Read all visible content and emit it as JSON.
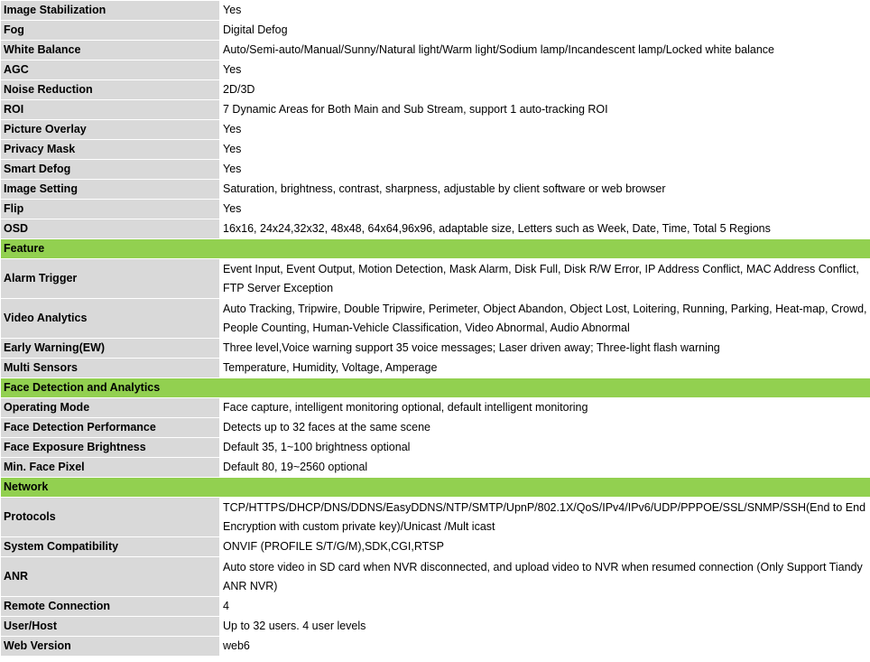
{
  "rows": [
    {
      "type": "row",
      "key": "Image Stabilization",
      "value": "Yes"
    },
    {
      "type": "row",
      "key": "Fog",
      "value": "Digital Defog"
    },
    {
      "type": "row",
      "key": "White Balance",
      "value": "Auto/Semi-auto/Manual/Sunny/Natural light/Warm light/Sodium lamp/Incandescent lamp/Locked white balance"
    },
    {
      "type": "row",
      "key": "AGC",
      "value": "Yes"
    },
    {
      "type": "row",
      "key": "Noise Reduction",
      "value": "2D/3D"
    },
    {
      "type": "row",
      "key": "ROI",
      "value": "7 Dynamic Areas for Both Main and Sub Stream, support 1 auto-tracking ROI"
    },
    {
      "type": "row",
      "key": "Picture Overlay",
      "value": "Yes"
    },
    {
      "type": "row",
      "key": "Privacy Mask",
      "value": "Yes"
    },
    {
      "type": "row",
      "key": "Smart Defog",
      "value": "Yes"
    },
    {
      "type": "row",
      "key": "Image Setting",
      "value": "Saturation, brightness, contrast, sharpness, adjustable by client software or web browser"
    },
    {
      "type": "row",
      "key": "Flip",
      "value": "Yes"
    },
    {
      "type": "row",
      "key": "OSD",
      "value": "16x16, 24x24,32x32, 48x48, 64x64,96x96, adaptable size, Letters such as Week, Date, Time, Total 5 Regions"
    },
    {
      "type": "header",
      "label": "Feature"
    },
    {
      "type": "row",
      "key": "Alarm Trigger",
      "value": "Event Input, Event Output, Motion Detection, Mask Alarm, Disk Full, Disk R/W Error, IP Address Conflict, MAC Address Conflict, FTP Server Exception",
      "tall": true
    },
    {
      "type": "row",
      "key": "Video Analytics",
      "value": "Auto Tracking, Tripwire, Double Tripwire, Perimeter, Object Abandon, Object Lost, Loitering, Running, Parking, Heat-map, Crowd, People Counting, Human-Vehicle Classification, Video Abnormal, Audio Abnormal",
      "tall": true
    },
    {
      "type": "row",
      "key": "Early Warning(EW)",
      "value": "Three level,Voice warning support 35 voice messages; Laser driven away; Three-light flash warning"
    },
    {
      "type": "row",
      "key": "Multi Sensors",
      "value": "Temperature, Humidity, Voltage, Amperage"
    },
    {
      "type": "header",
      "label": "Face Detection and Analytics"
    },
    {
      "type": "row",
      "key": "Operating Mode",
      "value": "Face capture, intelligent monitoring optional, default intelligent monitoring"
    },
    {
      "type": "row",
      "key": "Face Detection Performance",
      "value": "Detects up to 32 faces at the same scene"
    },
    {
      "type": "row",
      "key": "Face Exposure Brightness",
      "value": "Default 35, 1~100 brightness optional"
    },
    {
      "type": "row",
      "key": "Min. Face Pixel",
      "value": "Default 80, 19~2560 optional"
    },
    {
      "type": "header",
      "label": "Network"
    },
    {
      "type": "row",
      "key": "Protocols",
      "value": "TCP/HTTPS/DHCP/DNS/DDNS/EasyDDNS/NTP/SMTP/UpnP/802.1X/QoS/IPv4/IPv6/UDP/PPPOE/SSL/SNMP/SSH(End to End Encryption with custom private key)/Unicast /Mult icast",
      "tall": true
    },
    {
      "type": "row",
      "key": "System Compatibility",
      "value": "ONVIF (PROFILE S/T/G/M),SDK,CGI,RTSP"
    },
    {
      "type": "row",
      "key": "ANR",
      "value": "Auto store video in SD card when NVR disconnected, and upload video to NVR when resumed connection (Only Support Tiandy ANR NVR)",
      "tall": true
    },
    {
      "type": "row",
      "key": "Remote Connection",
      "value": "4"
    },
    {
      "type": "row",
      "key": "User/Host",
      "value": "Up to 32 users. 4 user levels"
    },
    {
      "type": "row",
      "key": "Web Version",
      "value": "web6"
    }
  ]
}
